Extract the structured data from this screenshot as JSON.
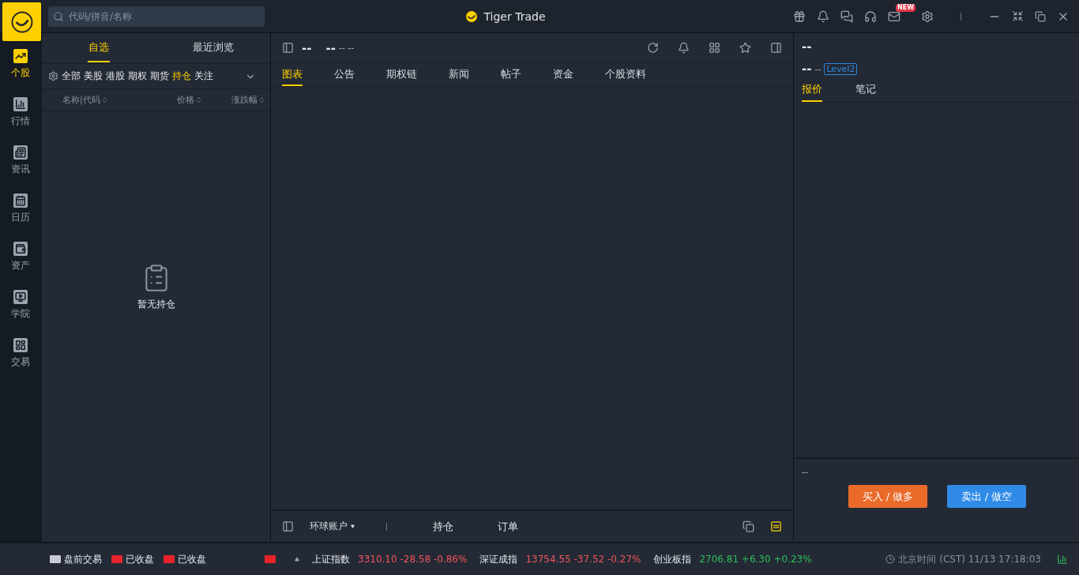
{
  "app_title": "Tiger Trade",
  "search": {
    "placeholder": "代码/拼音/名称"
  },
  "mail_badge": "NEW",
  "nav": [
    {
      "label": "个股",
      "selected": true
    },
    {
      "label": "行情",
      "selected": false
    },
    {
      "label": "资讯",
      "selected": false
    },
    {
      "label": "日历",
      "selected": false
    },
    {
      "label": "资产",
      "selected": false
    },
    {
      "label": "学院",
      "selected": false
    },
    {
      "label": "交易",
      "selected": false
    }
  ],
  "watchlist": {
    "tabs": [
      {
        "label": "自选",
        "selected": true
      },
      {
        "label": "最近浏览",
        "selected": false
      }
    ],
    "filters": [
      {
        "label": "全部",
        "selected": false
      },
      {
        "label": "美股",
        "selected": false
      },
      {
        "label": "港股",
        "selected": false
      },
      {
        "label": "期权",
        "selected": false
      },
      {
        "label": "期货",
        "selected": false
      },
      {
        "label": "持仓",
        "selected": true
      },
      {
        "label": "关注",
        "selected": false
      }
    ],
    "columns": [
      "名称|代码",
      "价格",
      "涨跌幅"
    ],
    "empty_text": "暂无持仓"
  },
  "quote": {
    "symbol": "--",
    "price": "--",
    "change": "-- --",
    "tabs": [
      {
        "label": "图表",
        "selected": true
      },
      {
        "label": "公告",
        "selected": false
      },
      {
        "label": "期权链",
        "selected": false
      },
      {
        "label": "新闻",
        "selected": false
      },
      {
        "label": "帖子",
        "selected": false
      },
      {
        "label": "资金",
        "selected": false
      },
      {
        "label": "个股资料",
        "selected": false
      }
    ]
  },
  "account_bar": {
    "account": "环球账户",
    "tabs": [
      "持仓",
      "订单"
    ]
  },
  "detail": {
    "title": "--",
    "price": "--",
    "change": "--",
    "badge": "Level2",
    "tabs": [
      {
        "label": "报价",
        "selected": true
      },
      {
        "label": "笔记",
        "selected": false
      }
    ],
    "order_info": "--",
    "buttons": [
      {
        "label": "买入 / 做多",
        "kind": "buy"
      },
      {
        "label": "卖出 / 做空",
        "kind": "sell"
      }
    ]
  },
  "status_bar": {
    "markets": [
      {
        "kind": "us",
        "label": "盘前交易"
      },
      {
        "kind": "hk",
        "label": "已收盘"
      },
      {
        "kind": "cn",
        "label": "已收盘"
      }
    ],
    "indices": [
      {
        "name": "上证指数",
        "value": "3310.10 -28.58 -0.86%",
        "color": "#f2545b"
      },
      {
        "name": "深证成指",
        "value": "13754.55 -37.52 -0.27%",
        "color": "#f2545b"
      },
      {
        "name": "创业板指",
        "value": "2706.81 +6.30 +0.23%",
        "color": "#2fbf5a"
      }
    ],
    "time": "北京时间 (CST) 11/13 17:18:03"
  }
}
